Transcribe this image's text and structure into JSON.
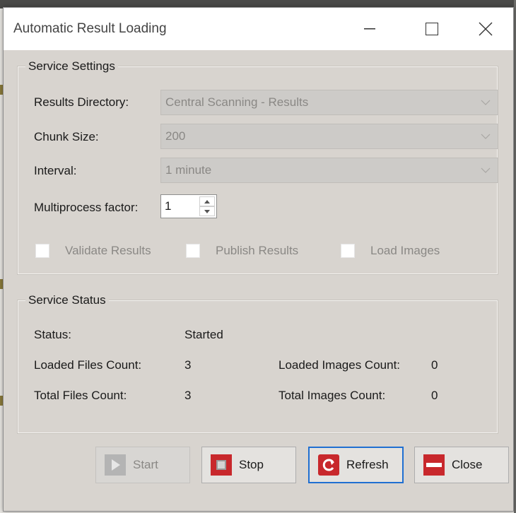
{
  "window": {
    "title": "Automatic Result Loading"
  },
  "settings": {
    "group_title": "Service Settings",
    "results_directory": {
      "label": "Results Directory:",
      "value": "Central Scanning - Results"
    },
    "chunk_size": {
      "label": "Chunk Size:",
      "value": "200"
    },
    "interval": {
      "label": "Interval:",
      "value": "1 minute"
    },
    "multiprocess_factor": {
      "label": "Multiprocess factor:",
      "value": "1"
    },
    "validate_results": "Validate Results",
    "publish_results": "Publish Results",
    "load_images": "Load Images"
  },
  "status": {
    "group_title": "Service Status",
    "status_label": "Status:",
    "status_value": "Started",
    "loaded_files_label": "Loaded Files Count:",
    "loaded_files_value": "3",
    "total_files_label": "Total Files Count:",
    "total_files_value": "3",
    "loaded_images_label": "Loaded Images Count:",
    "loaded_images_value": "0",
    "total_images_label": "Total Images Count:",
    "total_images_value": "0"
  },
  "buttons": {
    "start": "Start",
    "stop": "Stop",
    "refresh": "Refresh",
    "close": "Close"
  },
  "colors": {
    "disabled_text": "#8a8885",
    "stop_icon": "#c8282c",
    "focus_border": "#1f6fd1"
  }
}
